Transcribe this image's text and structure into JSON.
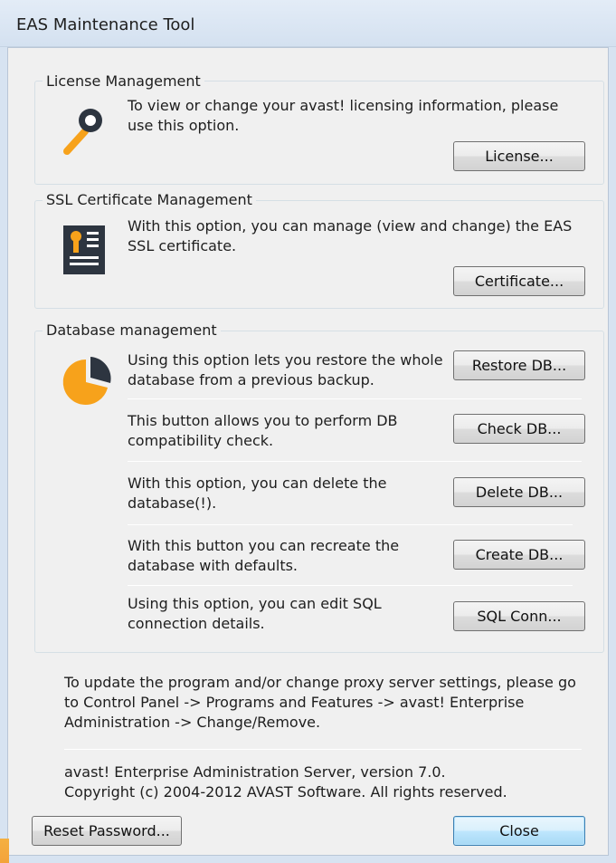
{
  "window": {
    "title": "EAS Maintenance Tool"
  },
  "license": {
    "group_label": "License Management",
    "description": "To view or change your avast! licensing information, please use this option.",
    "button_label": "License...",
    "icon": "key-icon"
  },
  "ssl": {
    "group_label": "SSL Certificate Management",
    "description": "With this option, you can manage (view and change) the EAS SSL certificate.",
    "button_label": "Certificate...",
    "icon": "certificate-icon"
  },
  "database": {
    "group_label": "Database management",
    "icon": "pie-chart-icon",
    "rows": [
      {
        "description": "Using this option lets you restore the whole database from a previous backup.",
        "button_label": "Restore DB..."
      },
      {
        "description": "This button allows you to perform DB compatibility check.",
        "button_label": "Check DB..."
      },
      {
        "description": "With this option, you can delete the database(!).",
        "button_label": "Delete DB..."
      },
      {
        "description": "With this button you can recreate the database with defaults.",
        "button_label": "Create DB..."
      },
      {
        "description": "Using this option, you can edit SQL connection details.",
        "button_label": "SQL Conn..."
      }
    ]
  },
  "info": {
    "update_note": "To update the program and/or change proxy server settings, please go to Control Panel -> Programs and Features -> avast! Enterprise Administration -> Change/Remove.",
    "version": "avast! Enterprise Administration Server, version 7.0.",
    "copyright": "Copyright (c) 2004-2012 AVAST Software. All rights reserved."
  },
  "footer": {
    "reset_label": "Reset Password...",
    "close_label": "Close"
  },
  "colors": {
    "icon_orange": "#f7a21b",
    "icon_dark": "#2d3540",
    "primary_border": "#3c7fb1"
  }
}
